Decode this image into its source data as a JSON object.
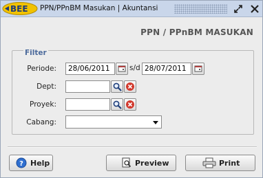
{
  "window": {
    "logo_text": "BEE",
    "title": "PPN/PPnBM Masukan | Akuntansi"
  },
  "header": {
    "title": "PPN / PPnBM MASUKAN"
  },
  "filter": {
    "legend": "Filter",
    "periode": {
      "label": "Periode:",
      "from": "28/06/2011",
      "separator": "s/d",
      "to": "28/07/2011"
    },
    "dept": {
      "label": "Dept:",
      "value": ""
    },
    "proyek": {
      "label": "Proyek:",
      "value": ""
    },
    "cabang": {
      "label": "Cabang:",
      "selected": ""
    }
  },
  "buttons": {
    "help": "Help",
    "preview": "Preview",
    "print": "Print"
  },
  "colors": {
    "titlebar": "#c9d6ea",
    "legend": "#4b6a9b",
    "clear_red": "#d23a2e",
    "logo_yellow": "#f2c200"
  },
  "icons": [
    "bee-logo",
    "restore-icon",
    "close-icon",
    "calendar-icon",
    "search-icon",
    "clear-icon",
    "help-icon",
    "preview-icon",
    "printer-icon"
  ]
}
